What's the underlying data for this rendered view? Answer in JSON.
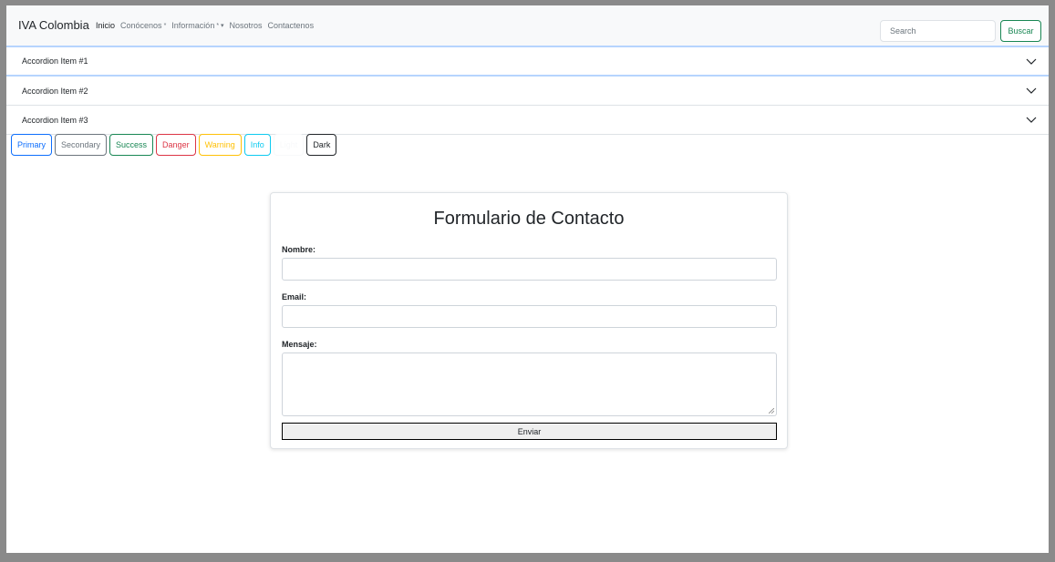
{
  "navbar": {
    "brand": "IVA Colombia",
    "links": [
      {
        "label": "Inicio",
        "active": true,
        "caret": ""
      },
      {
        "label": "Conócenos",
        "active": false,
        "caret": "*"
      },
      {
        "label": "Información",
        "active": false,
        "caret": "* ▾"
      },
      {
        "label": "Nosotros",
        "active": false,
        "caret": ""
      },
      {
        "label": "Contactenos",
        "active": false,
        "caret": ""
      }
    ],
    "search_placeholder": "Search",
    "search_button": "Buscar"
  },
  "accordion": {
    "items": [
      {
        "title": "Accordion Item #1"
      },
      {
        "title": "Accordion Item #2"
      },
      {
        "title": "Accordion Item #3"
      }
    ]
  },
  "buttons": [
    {
      "label": "Primary",
      "color": "#0d6efd"
    },
    {
      "label": "Secondary",
      "color": "#6c757d"
    },
    {
      "label": "Success",
      "color": "#198754"
    },
    {
      "label": "Danger",
      "color": "#dc3545"
    },
    {
      "label": "Warning",
      "color": "#ffc107"
    },
    {
      "label": "Info",
      "color": "#0dcaf0"
    },
    {
      "label": "Light",
      "color": "#f8f9fa"
    },
    {
      "label": "Dark",
      "color": "#212529"
    }
  ],
  "form": {
    "title": "Formulario de Contacto",
    "name_label": "Nombre:",
    "email_label": "Email:",
    "message_label": "Mensaje:",
    "submit_label": "Enviar"
  }
}
